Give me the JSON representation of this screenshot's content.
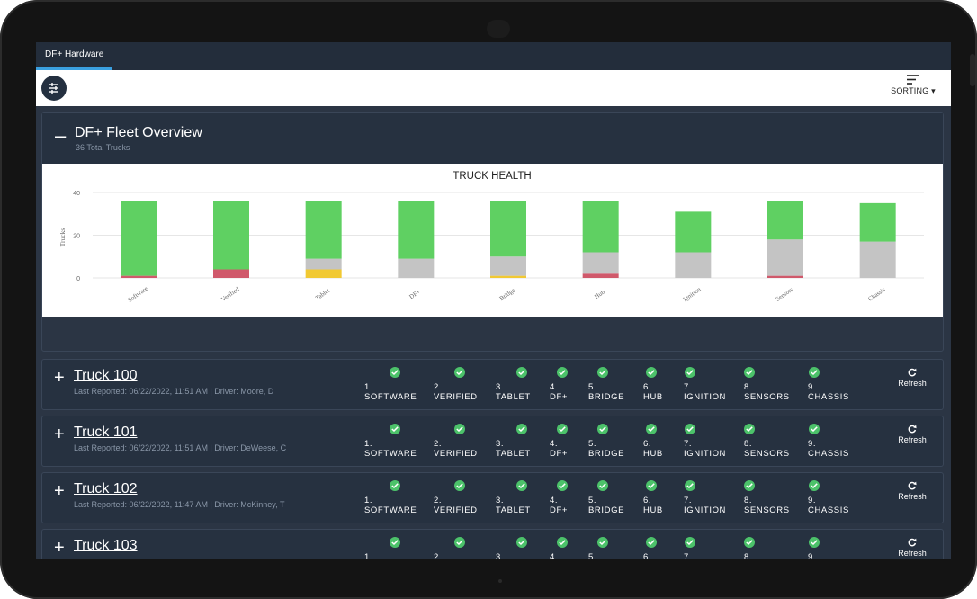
{
  "app": {
    "tab_label": "DF+ Hardware",
    "sorting_label": "SORTING ▾"
  },
  "fleet": {
    "title": "DF+ Fleet Overview",
    "subtitle": "36 Total Trucks"
  },
  "colors": {
    "ok": "#5fd062",
    "gray": "#c4c4c4",
    "red": "#d0596b",
    "yellow": "#f1c933",
    "check": "#4cc26a"
  },
  "chart_data": {
    "type": "bar",
    "stacked": true,
    "title": "TRUCK HEALTH",
    "ylabel": "Trucks",
    "xlabel": "",
    "ylim": [
      0,
      40
    ],
    "yticks": [
      0,
      20,
      40
    ],
    "grid": true,
    "categories": [
      "Software",
      "Verified",
      "Tablet",
      "DF+",
      "Bridge",
      "Hub",
      "Ignition",
      "Sensors",
      "Chassis"
    ],
    "series": [
      {
        "color": "#d0596b",
        "values": [
          1,
          4,
          0,
          0,
          0,
          2,
          0,
          1,
          0
        ]
      },
      {
        "color": "#f1c933",
        "values": [
          0,
          0,
          4,
          0,
          1,
          0,
          0,
          0,
          0
        ]
      },
      {
        "color": "#c4c4c4",
        "values": [
          0,
          0,
          5,
          9,
          9,
          10,
          12,
          17,
          17
        ]
      },
      {
        "color": "#5fd062",
        "values": [
          35,
          32,
          27,
          27,
          26,
          24,
          19,
          18,
          18
        ]
      }
    ]
  },
  "checks": [
    {
      "num": "1.",
      "label": "SOFTWARE"
    },
    {
      "num": "2.",
      "label": "VERIFIED"
    },
    {
      "num": "3.",
      "label": "TABLET"
    },
    {
      "num": "4.",
      "label": "DF+"
    },
    {
      "num": "5.",
      "label": "BRIDGE"
    },
    {
      "num": "6.",
      "label": "HUB"
    },
    {
      "num": "7.",
      "label": "IGNITION"
    },
    {
      "num": "8.",
      "label": "SENSORS"
    },
    {
      "num": "9.",
      "label": "CHASSIS"
    }
  ],
  "refresh_label": "Refresh",
  "trucks": [
    {
      "name": "Truck 100",
      "meta": "Last Reported: 06/22/2022, 11:51 AM | Driver: Moore, D"
    },
    {
      "name": "Truck 101",
      "meta": "Last Reported: 06/22/2022, 11:51 AM | Driver: DeWeese, C"
    },
    {
      "name": "Truck 102",
      "meta": "Last Reported: 06/22/2022, 11:47 AM | Driver: McKinney, T"
    },
    {
      "name": "Truck 103",
      "meta": ""
    }
  ]
}
